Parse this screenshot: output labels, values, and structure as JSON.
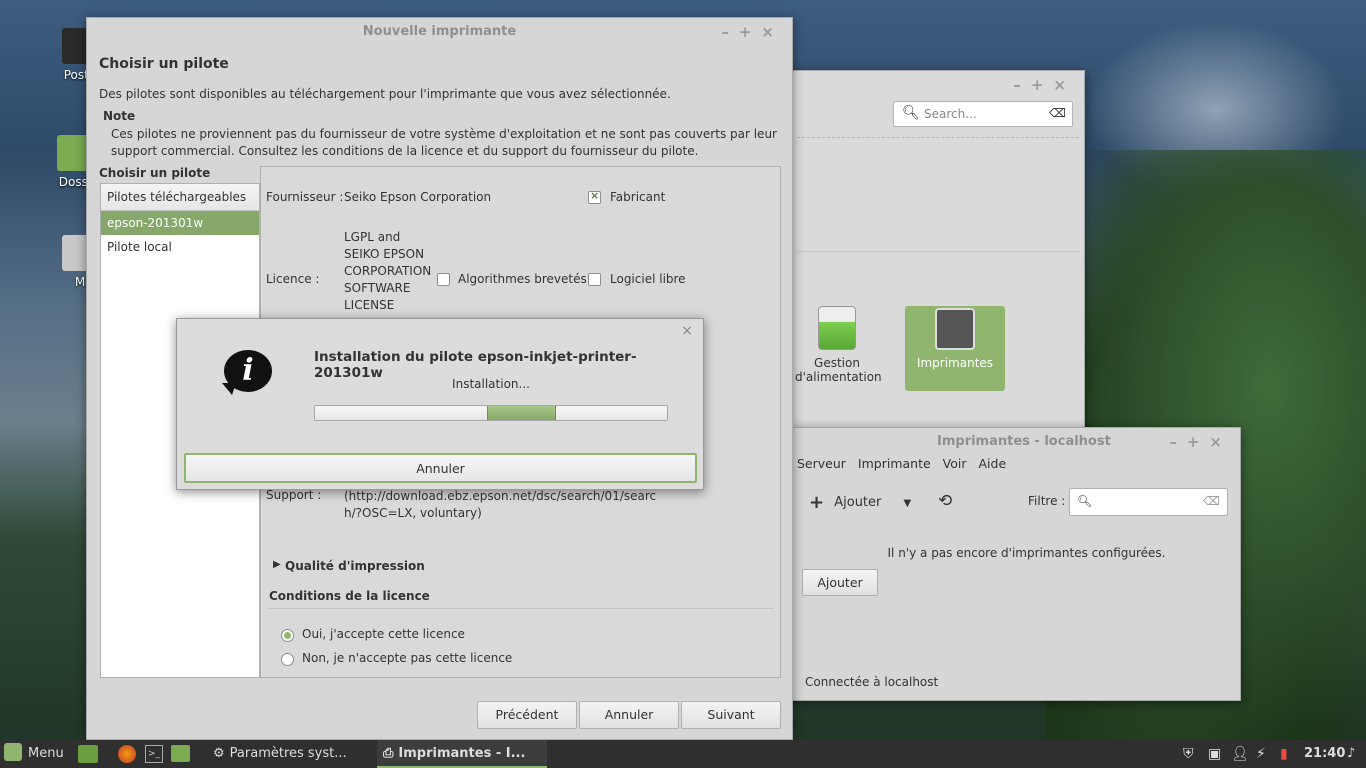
{
  "desktop": {
    "icons": [
      {
        "label": "Poste"
      },
      {
        "label": "Dossi"
      },
      {
        "label": "M"
      }
    ]
  },
  "settings_window": {
    "search_placeholder": "Search...",
    "items": [
      {
        "label": "Gestion d'alimentation"
      },
      {
        "label": "Imprimantes"
      }
    ]
  },
  "printers_window": {
    "title": "Imprimantes - localhost",
    "menu": [
      "Serveur",
      "Imprimante",
      "Voir",
      "Aide"
    ],
    "add_label": "Ajouter",
    "filter_label": "Filtre :",
    "empty_message": "Il n'y a pas encore d'imprimantes configurées.",
    "add_button": "Ajouter",
    "status": "Connectée à localhost"
  },
  "new_printer": {
    "title": "Nouvelle imprimante",
    "heading": "Choisir un pilote",
    "subtitle": "Des pilotes sont disponibles au téléchargement pour l'imprimante que vous avez sélectionnée.",
    "note_title": "Note",
    "note_text": "Ces pilotes ne proviennent pas du fournisseur de votre système d'exploitation et ne sont pas couverts par leur support commercial. Consultez les conditions de la licence et du support du fournisseur du pilote.",
    "choose_label": "Choisir un pilote",
    "list_header": "Pilotes téléchargeables",
    "drivers": [
      "epson-201301w",
      "Pilote local"
    ],
    "supplier_label": "Fournisseur :",
    "supplier_value": "Seiko Epson Corporation",
    "manufacturer_label": "Fabricant",
    "license_label": "Licence :",
    "license_value": "LGPL and SEIKO EPSON CORPORATION SOFTWARE LICENSE",
    "patented_label": "Algorithmes brevetés",
    "free_label": "Logiciel libre",
    "support_label": "Support :",
    "support_value": "(http://download.ebz.epson.net/dsc/search/01/search/?OSC=LX, voluntary)",
    "quality_label": "Qualité d'impression",
    "conditions_label": "Conditions de la licence",
    "accept_label": "Oui, j'accepte cette licence",
    "reject_label": "Non, je n'accepte pas cette licence",
    "btn_prev": "Précédent",
    "btn_cancel": "Annuler",
    "btn_next": "Suivant"
  },
  "install_dialog": {
    "title": "Installation du pilote epson-inkjet-printer-201301w",
    "status": "Installation...",
    "progress_start": 0.49,
    "progress_end": 0.685,
    "cancel": "Annuler"
  },
  "taskbar": {
    "menu_label": "Menu",
    "windows": [
      "Paramètres syst...",
      "Imprimantes - I..."
    ],
    "clock": "21:40"
  },
  "colors": {
    "accent": "#8fb56f",
    "selected": "#86a86a"
  }
}
